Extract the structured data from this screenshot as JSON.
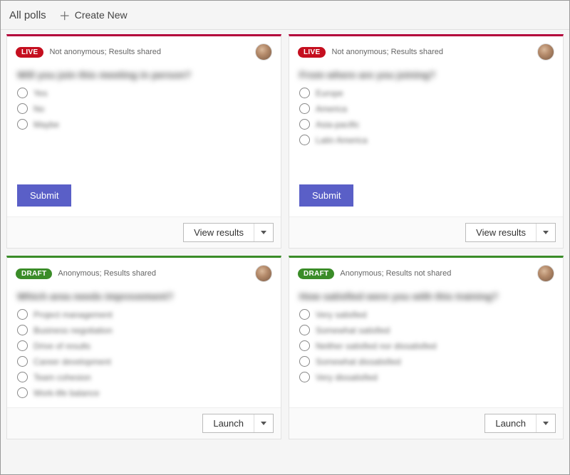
{
  "header": {
    "tab_label": "All polls",
    "create_label": "Create New"
  },
  "buttons": {
    "submit": "Submit",
    "view_results": "View results",
    "launch": "Launch"
  },
  "badges": {
    "live": "LIVE",
    "draft": "DRAFT"
  },
  "polls": [
    {
      "status": "live",
      "meta": "Not anonymous; Results shared",
      "question": "Will you join this meeting in person?",
      "options": [
        "Yes",
        "No",
        "Maybe"
      ],
      "has_submit": true,
      "footer_action": "view_results"
    },
    {
      "status": "live",
      "meta": "Not anonymous; Results shared",
      "question": "From where are you joining?",
      "options": [
        "Europe",
        "America",
        "Asia-pacific",
        "Latin America"
      ],
      "has_submit": true,
      "footer_action": "view_results"
    },
    {
      "status": "draft",
      "meta": "Anonymous; Results shared",
      "question": "Which area needs improvement?",
      "options": [
        "Project management",
        "Business negotiation",
        "Drive of results",
        "Career development",
        "Team cohesion",
        "Work-life balance"
      ],
      "has_submit": false,
      "footer_action": "launch"
    },
    {
      "status": "draft",
      "meta": "Anonymous; Results not shared",
      "question": "How satisfied were you with this training?",
      "options": [
        "Very satisfied",
        "Somewhat satisfied",
        "Neither satisfied nor dissatisfied",
        "Somewhat dissatisfied",
        "Very dissatisfied"
      ],
      "has_submit": false,
      "footer_action": "launch"
    }
  ]
}
